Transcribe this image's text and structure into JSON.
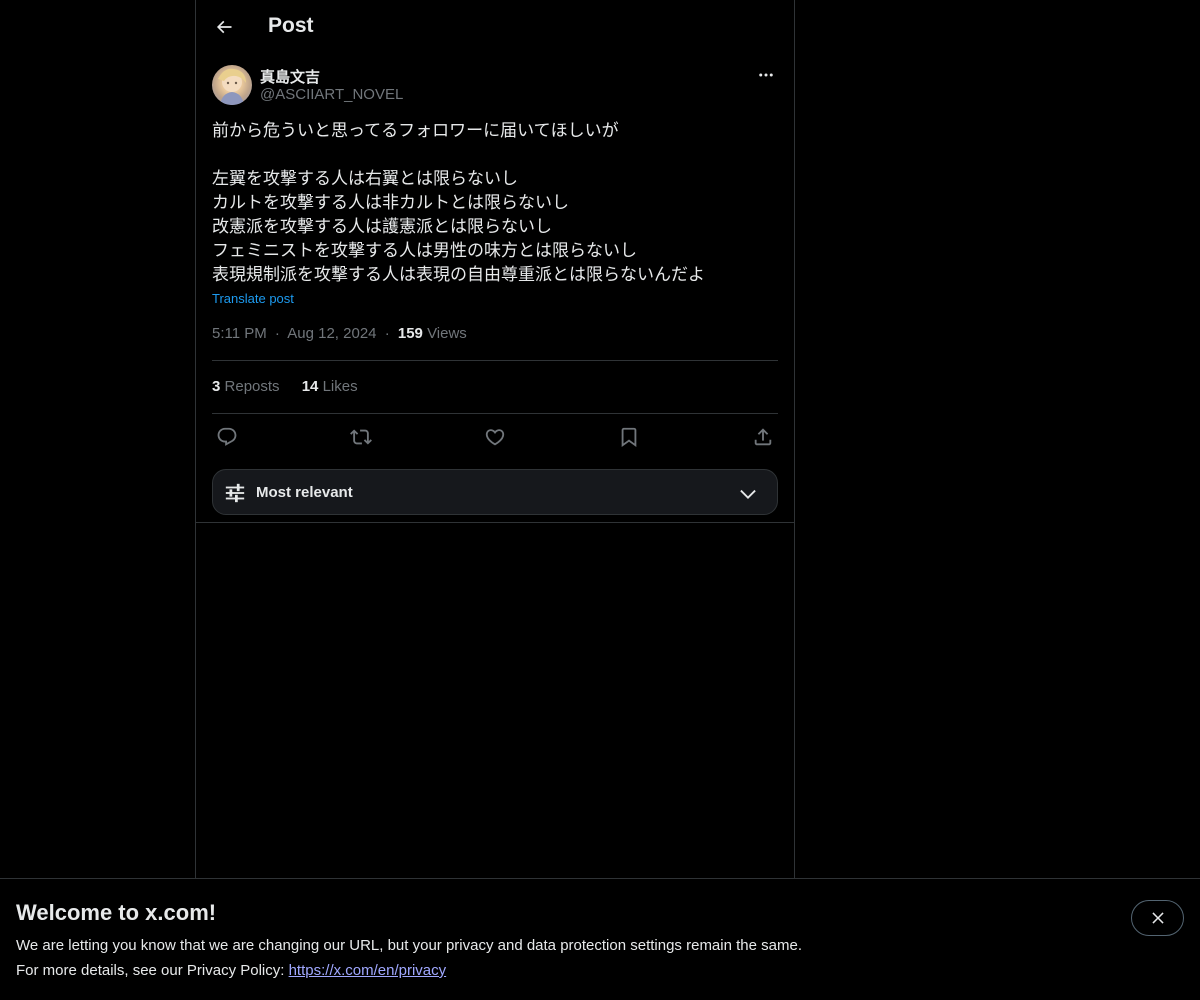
{
  "header": {
    "title": "Post"
  },
  "author": {
    "display_name": "真島文吉",
    "handle": "@ASCIIART_NOVEL"
  },
  "tweet": {
    "lines": [
      "前から危ういと思ってるフォロワーに届いてほしいが",
      "",
      "左翼を攻撃する人は右翼とは限らないし",
      "カルトを攻撃する人は非カルトとは限らないし",
      "改憲派を攻撃する人は護憲派とは限らないし",
      "フェミニストを攻撃する人は男性の味方とは限らないし",
      "表現規制派を攻撃する人は表現の自由尊重派とは限らないんだよ"
    ],
    "translate_label": "Translate post",
    "time": "5:11 PM",
    "separator": "·",
    "date": "Aug 12, 2024",
    "views_count": "159",
    "views_label": "Views"
  },
  "stats": {
    "reposts_count": "3",
    "reposts_label": "Reposts",
    "likes_count": "14",
    "likes_label": "Likes"
  },
  "sort": {
    "label": "Most relevant"
  },
  "banner": {
    "title": "Welcome to x.com!",
    "text1": "We are letting you know that we are changing our URL, but your privacy and data protection settings remain the same.",
    "text2_prefix": "For more details, see our Privacy Policy: ",
    "link": "https://x.com/en/privacy"
  },
  "icons": {
    "back": "arrow-left-icon",
    "more": "ellipsis-icon",
    "reply": "reply-icon",
    "repost": "repost-icon",
    "like": "heart-icon",
    "bookmark": "bookmark-icon",
    "share": "share-icon",
    "sort": "sliders-icon",
    "chevron": "chevron-down-icon",
    "close": "close-icon"
  },
  "colors": {
    "accent": "#1d9bf0",
    "muted": "#71767b",
    "border": "#2f3336",
    "link": "#a0a8ff"
  }
}
